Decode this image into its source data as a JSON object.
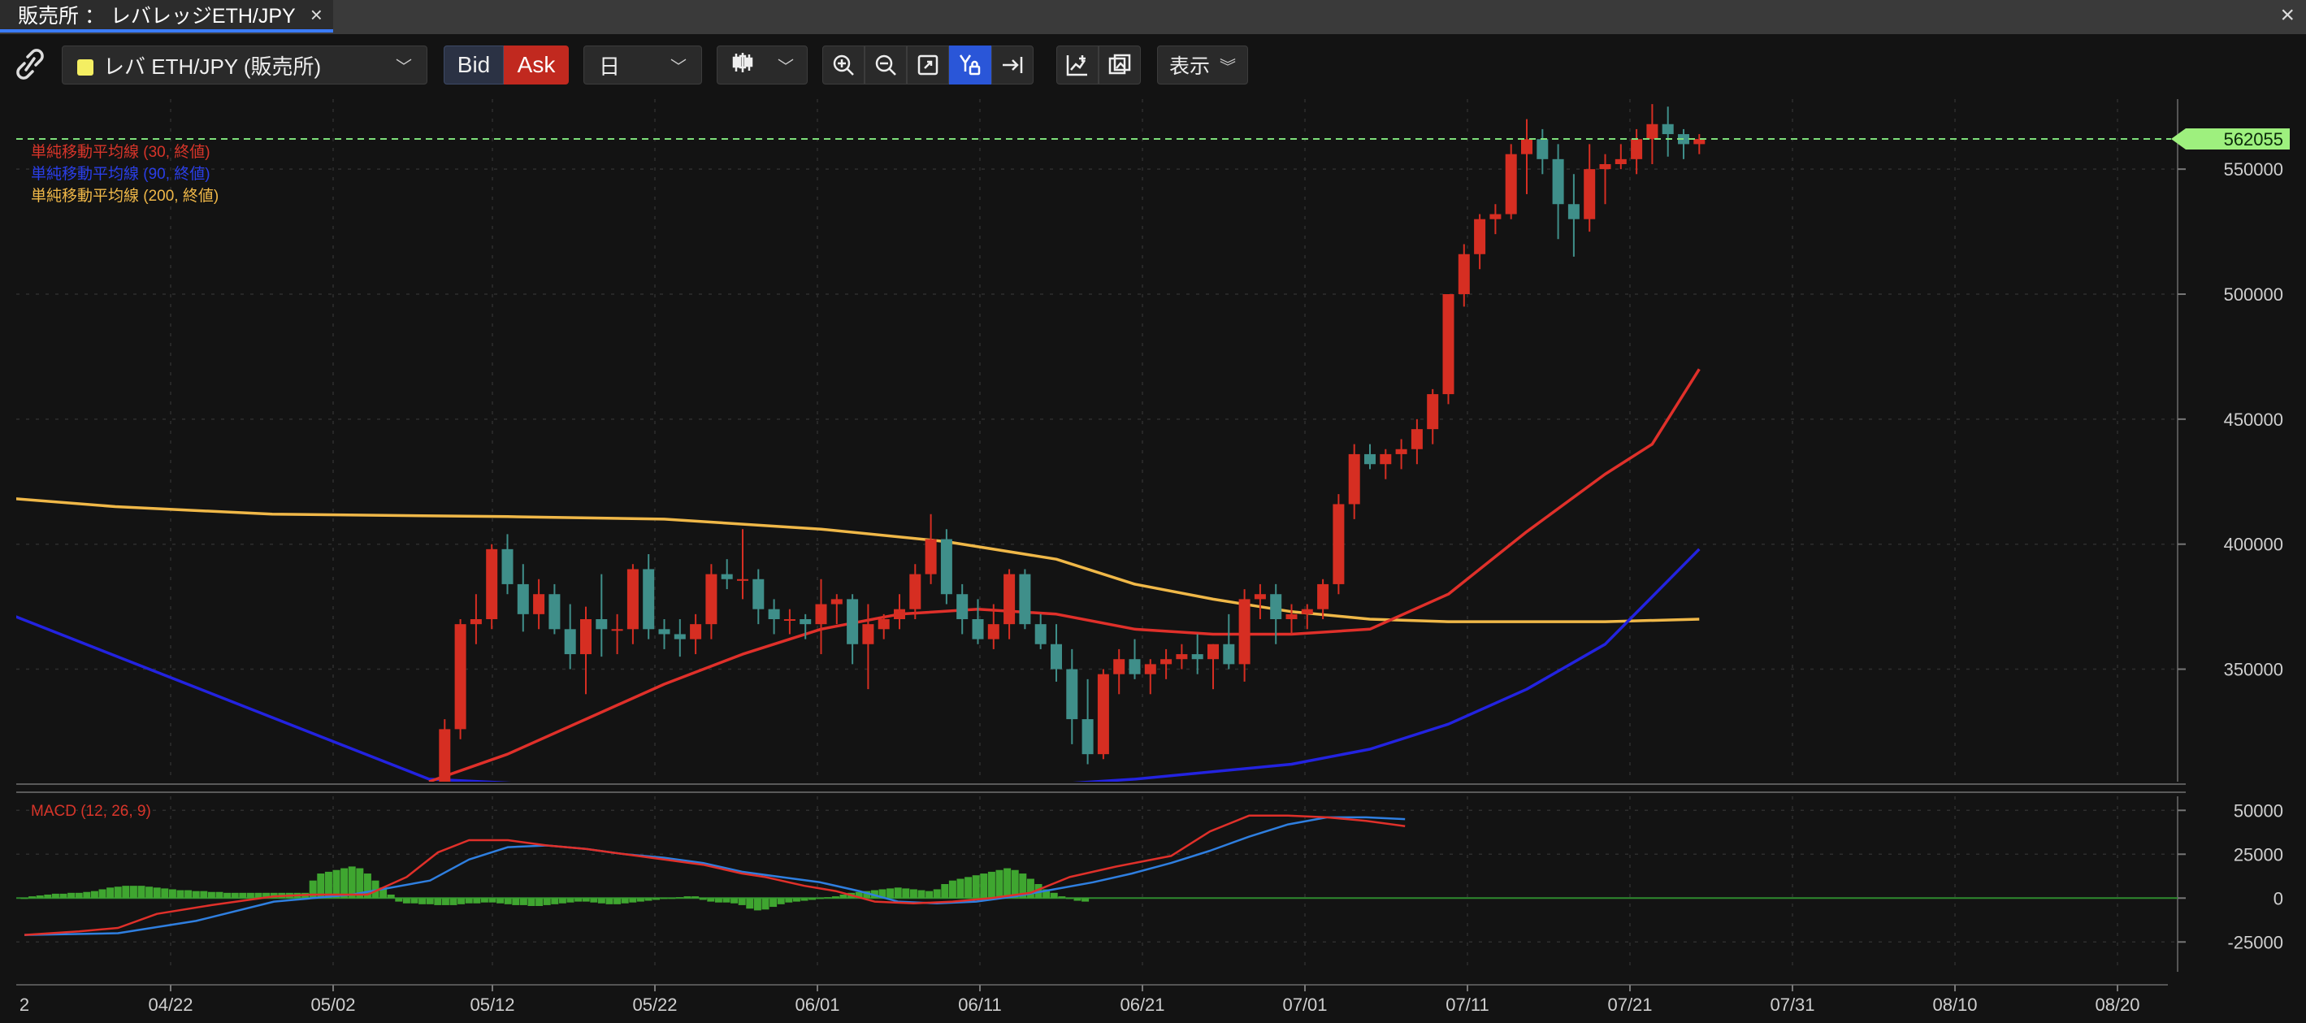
{
  "window": {
    "tab_title": "販売所 ： レバレッジETH/JPY",
    "tab_close": "×",
    "window_close": "×"
  },
  "toolbar": {
    "symbol": "レバ ETH/JPY (販売所)",
    "symbol_color": "#f4ee62",
    "bid_label": "Bid",
    "ask_label": "Ask",
    "period": "日",
    "display_label": "表示",
    "icons": [
      "link-icon",
      "candlestick-icon",
      "zoom-in-icon",
      "zoom-out-icon",
      "fit-screen-icon",
      "y-axis-lock-icon",
      "scroll-to-latest-icon",
      "add-indicator-icon",
      "screenshot-icon"
    ]
  },
  "legend": {
    "sma30": "単純移動平均線 (30, 終値)",
    "sma90": "単純移動平均線 (90, 終値)",
    "sma200": "単純移動平均線 (200, 終値)",
    "macd": "MACD (12, 26, 9)"
  },
  "current_price_label": "562055",
  "chart_data": {
    "type": "candlestick",
    "x_ticks": [
      "2",
      "04/22",
      "05/02",
      "05/12",
      "05/22",
      "06/01",
      "06/11",
      "06/21",
      "07/01",
      "07/11",
      "07/21",
      "07/31",
      "08/10",
      "08/20"
    ],
    "y_ticks": [
      "550000",
      "500000",
      "450000",
      "400000",
      "350000"
    ],
    "ylim": [
      305000,
      578000
    ],
    "current_price": 562055,
    "first_date": "05/08",
    "ohlc": [
      [
        290000,
        305000,
        280000,
        302000
      ],
      [
        302000,
        330000,
        298000,
        326000
      ],
      [
        326000,
        370000,
        322000,
        368000
      ],
      [
        368000,
        380000,
        360000,
        370000
      ],
      [
        370000,
        400000,
        366000,
        398000
      ],
      [
        398000,
        404000,
        380000,
        384000
      ],
      [
        384000,
        392000,
        365000,
        372000
      ],
      [
        372000,
        386000,
        366000,
        380000
      ],
      [
        380000,
        384000,
        364000,
        366000
      ],
      [
        366000,
        376000,
        350000,
        356000
      ],
      [
        356000,
        375000,
        340000,
        370000
      ],
      [
        370000,
        388000,
        355000,
        366000
      ],
      [
        366000,
        372000,
        356000,
        366000
      ],
      [
        366000,
        392000,
        360000,
        390000
      ],
      [
        390000,
        396000,
        362000,
        366000
      ],
      [
        366000,
        370000,
        358000,
        364000
      ],
      [
        364000,
        370000,
        355000,
        362000
      ],
      [
        362000,
        372000,
        356000,
        368000
      ],
      [
        368000,
        392000,
        362000,
        388000
      ],
      [
        388000,
        394000,
        382000,
        386000
      ],
      [
        386000,
        406000,
        378000,
        386000
      ],
      [
        386000,
        390000,
        368000,
        374000
      ],
      [
        374000,
        378000,
        364000,
        370000
      ],
      [
        370000,
        374000,
        364000,
        370000
      ],
      [
        370000,
        372000,
        362000,
        368000
      ],
      [
        368000,
        386000,
        356000,
        376000
      ],
      [
        376000,
        380000,
        368000,
        378000
      ],
      [
        378000,
        380000,
        352000,
        360000
      ],
      [
        360000,
        376000,
        342000,
        368000
      ],
      [
        366000,
        372000,
        362000,
        370000
      ],
      [
        370000,
        380000,
        366000,
        374000
      ],
      [
        374000,
        392000,
        370000,
        388000
      ],
      [
        388000,
        412000,
        384000,
        402000
      ],
      [
        402000,
        406000,
        376000,
        380000
      ],
      [
        380000,
        384000,
        364000,
        370000
      ],
      [
        370000,
        378000,
        360000,
        362000
      ],
      [
        362000,
        376000,
        358000,
        368000
      ],
      [
        368000,
        390000,
        362000,
        388000
      ],
      [
        388000,
        390000,
        366000,
        368000
      ],
      [
        368000,
        372000,
        358000,
        360000
      ],
      [
        360000,
        368000,
        345000,
        350000
      ],
      [
        350000,
        358000,
        320000,
        330000
      ],
      [
        330000,
        346000,
        312000,
        316000
      ],
      [
        316000,
        350000,
        314000,
        348000
      ],
      [
        348000,
        358000,
        340000,
        354000
      ],
      [
        354000,
        362000,
        346000,
        348000
      ],
      [
        348000,
        354000,
        340000,
        352000
      ],
      [
        352000,
        358000,
        346000,
        354000
      ],
      [
        354000,
        360000,
        350000,
        356000
      ],
      [
        356000,
        364000,
        348000,
        354000
      ],
      [
        354000,
        360000,
        342000,
        360000
      ],
      [
        360000,
        372000,
        350000,
        352000
      ],
      [
        352000,
        382000,
        345000,
        378000
      ],
      [
        378000,
        384000,
        370000,
        380000
      ],
      [
        380000,
        384000,
        360000,
        370000
      ],
      [
        370000,
        376000,
        364000,
        372000
      ],
      [
        372000,
        376000,
        366000,
        374000
      ],
      [
        374000,
        386000,
        370000,
        384000
      ],
      [
        384000,
        420000,
        380000,
        416000
      ],
      [
        416000,
        440000,
        410000,
        436000
      ],
      [
        436000,
        440000,
        430000,
        432000
      ],
      [
        432000,
        438000,
        426000,
        436000
      ],
      [
        436000,
        442000,
        430000,
        438000
      ],
      [
        438000,
        450000,
        432000,
        446000
      ],
      [
        446000,
        462000,
        440000,
        460000
      ],
      [
        460000,
        500000,
        456000,
        500000
      ],
      [
        500000,
        520000,
        495000,
        516000
      ],
      [
        516000,
        532000,
        510000,
        530000
      ],
      [
        530000,
        536000,
        524000,
        532000
      ],
      [
        532000,
        560000,
        530000,
        556000
      ],
      [
        556000,
        570000,
        540000,
        562000
      ],
      [
        562000,
        566000,
        548000,
        554000
      ],
      [
        554000,
        560000,
        522000,
        536000
      ],
      [
        536000,
        548000,
        515000,
        530000
      ],
      [
        530000,
        560000,
        525000,
        550000
      ],
      [
        550000,
        556000,
        536000,
        552000
      ],
      [
        552000,
        560000,
        550000,
        554000
      ],
      [
        554000,
        566000,
        548000,
        562000
      ],
      [
        562000,
        576000,
        552000,
        568000
      ],
      [
        568000,
        575000,
        555000,
        564000
      ],
      [
        564000,
        566000,
        554000,
        560000
      ],
      [
        560000,
        564000,
        556000,
        562055
      ]
    ],
    "sma30": [
      [
        0,
        305000
      ],
      [
        5,
        316000
      ],
      [
        10,
        330000
      ],
      [
        15,
        344000
      ],
      [
        20,
        356000
      ],
      [
        25,
        366000
      ],
      [
        30,
        372000
      ],
      [
        35,
        374000
      ],
      [
        40,
        372000
      ],
      [
        45,
        366000
      ],
      [
        50,
        364000
      ],
      [
        55,
        364000
      ],
      [
        60,
        366000
      ],
      [
        65,
        380000
      ],
      [
        70,
        405000
      ],
      [
        75,
        428000
      ],
      [
        78,
        440000
      ],
      [
        81,
        470000
      ]
    ],
    "sma90": [
      [
        -30,
        380000
      ],
      [
        0,
        306000
      ],
      [
        20,
        300000
      ],
      [
        35,
        302000
      ],
      [
        45,
        306000
      ],
      [
        55,
        312000
      ],
      [
        60,
        318000
      ],
      [
        65,
        328000
      ],
      [
        70,
        342000
      ],
      [
        75,
        360000
      ],
      [
        81,
        398000
      ]
    ],
    "sma200": [
      [
        -50,
        428000
      ],
      [
        -30,
        420000
      ],
      [
        -20,
        415000
      ],
      [
        -10,
        412000
      ],
      [
        5,
        411000
      ],
      [
        15,
        410000
      ],
      [
        25,
        406000
      ],
      [
        33,
        401000
      ],
      [
        40,
        394000
      ],
      [
        45,
        384000
      ],
      [
        50,
        378000
      ],
      [
        55,
        373000
      ],
      [
        60,
        370000
      ],
      [
        65,
        369000
      ],
      [
        70,
        369000
      ],
      [
        75,
        369000
      ],
      [
        81,
        370000
      ]
    ],
    "macd": {
      "ylim": [
        -42000,
        58000
      ],
      "y_ticks": [
        "50000",
        "25000",
        "0",
        "-25000"
      ],
      "x_start": -52,
      "macd_line": [
        [
          -52,
          -21000
        ],
        [
          -45,
          -19000
        ],
        [
          -40,
          -17000
        ],
        [
          -35,
          -9000
        ],
        [
          -28,
          -4000
        ],
        [
          -20,
          1000
        ],
        [
          -15,
          2000
        ],
        [
          -8,
          2000
        ],
        [
          -3,
          12000
        ],
        [
          1,
          26000
        ],
        [
          5,
          33000
        ],
        [
          10,
          33000
        ],
        [
          15,
          30000
        ],
        [
          20,
          28000
        ],
        [
          25,
          25000
        ],
        [
          30,
          22000
        ],
        [
          35,
          19000
        ],
        [
          40,
          14000
        ],
        [
          43,
          12000
        ],
        [
          48,
          7000
        ],
        [
          52,
          4000
        ],
        [
          57,
          -2000
        ],
        [
          62,
          -3000
        ],
        [
          67,
          -2000
        ],
        [
          72,
          0
        ],
        [
          77,
          3000
        ],
        [
          82,
          12000
        ],
        [
          88,
          18000
        ],
        [
          95,
          24000
        ],
        [
          100,
          38000
        ],
        [
          105,
          47000
        ],
        [
          110,
          47000
        ],
        [
          115,
          46000
        ],
        [
          120,
          44000
        ],
        [
          125,
          41000
        ]
      ],
      "signal_line": [
        [
          -52,
          -21000
        ],
        [
          -40,
          -20000
        ],
        [
          -30,
          -13000
        ],
        [
          -20,
          -2000
        ],
        [
          -10,
          2000
        ],
        [
          0,
          10000
        ],
        [
          5,
          22000
        ],
        [
          10,
          29000
        ],
        [
          15,
          30000
        ],
        [
          20,
          28000
        ],
        [
          25,
          25000
        ],
        [
          30,
          23000
        ],
        [
          35,
          20000
        ],
        [
          40,
          15000
        ],
        [
          45,
          12000
        ],
        [
          50,
          9000
        ],
        [
          55,
          4000
        ],
        [
          60,
          -2000
        ],
        [
          65,
          -3000
        ],
        [
          70,
          -2000
        ],
        [
          75,
          1000
        ],
        [
          80,
          5000
        ],
        [
          85,
          9000
        ],
        [
          90,
          14000
        ],
        [
          95,
          20000
        ],
        [
          100,
          27000
        ],
        [
          105,
          35000
        ],
        [
          110,
          42000
        ],
        [
          115,
          46000
        ],
        [
          120,
          46000
        ],
        [
          125,
          45000
        ]
      ],
      "histogram": [
        0,
        1000,
        1500,
        2000,
        2500,
        2500,
        3000,
        3000,
        3500,
        4000,
        5000,
        6000,
        6500,
        7000,
        7000,
        7000,
        6500,
        6000,
        5500,
        5000,
        4500,
        4500,
        4000,
        4000,
        3500,
        3500,
        3000,
        3000,
        3000,
        3000,
        3000,
        3000,
        3000,
        3000,
        3000,
        3000,
        3000,
        10000,
        14000,
        15000,
        16000,
        17000,
        18000,
        17000,
        14000,
        10000,
        6000,
        2000,
        -2000,
        -3000,
        -3000,
        -3500,
        -3500,
        -4000,
        -4000,
        -4000,
        -3500,
        -3000,
        -3000,
        -2500,
        -2500,
        -3000,
        -3500,
        -4000,
        -4000,
        -4500,
        -4500,
        -4000,
        -3500,
        -3000,
        -2500,
        -2000,
        -2000,
        -2500,
        -3000,
        -3500,
        -3500,
        -3000,
        -2500,
        -2000,
        -1500,
        -1000,
        -500,
        0,
        500,
        1000,
        1000,
        -1000,
        -2000,
        -2500,
        -2500,
        -3000,
        -4000,
        -6000,
        -7000,
        -6500,
        -5000,
        -3500,
        -2500,
        -2000,
        -1500,
        -1000,
        -500,
        500,
        1000,
        2000,
        3000,
        3500,
        4000,
        4500,
        5000,
        5500,
        6000,
        5500,
        5000,
        4500,
        4000,
        5000,
        8000,
        10000,
        11000,
        12000,
        13000,
        14000,
        15000,
        16000,
        17000,
        16000,
        14000,
        11000,
        8000,
        5000,
        3000,
        1000,
        -500,
        -1500,
        -2000
      ]
    }
  }
}
